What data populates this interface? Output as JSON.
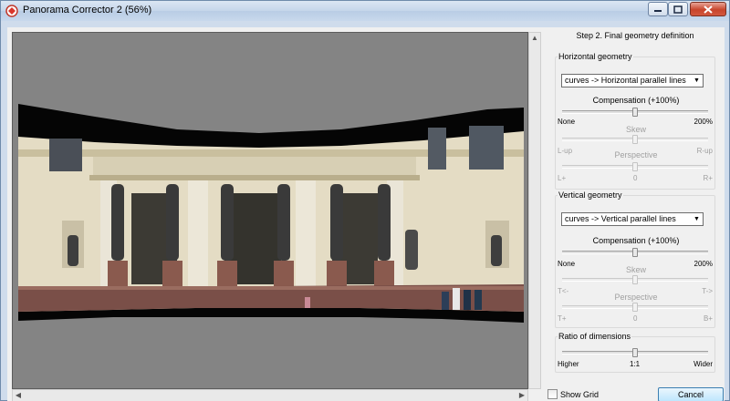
{
  "window": {
    "title": "Panorama Corrector 2 (56%)"
  },
  "panel": {
    "step_title": "Step 2. Final geometry definition",
    "horizontal": {
      "title": "Horizontal geometry",
      "combo_value": "curves -> Horizontal parallel lines",
      "compensation": {
        "label": "Compensation (+100%)",
        "min": "None",
        "max": "200%",
        "value": 0.5
      },
      "skew": {
        "label": "Skew",
        "value": 0.5
      },
      "perspective": {
        "label": "Perspective",
        "left": "L-up",
        "right": "R-up",
        "min": "L+",
        "center": "0",
        "max": "R+",
        "value": 0.5
      }
    },
    "vertical": {
      "title": "Vertical geometry",
      "combo_value": "curves -> Vertical parallel lines",
      "compensation": {
        "label": "Compensation (+100%)",
        "min": "None",
        "max": "200%",
        "value": 0.5
      },
      "skew": {
        "label": "Skew",
        "left": "T<-",
        "right": "T->",
        "value": 0.5
      },
      "perspective": {
        "label": "Perspective",
        "min": "T+",
        "center": "0",
        "max": "B+",
        "value": 0.5
      }
    },
    "ratio": {
      "title": "Ratio of dimensions",
      "min": "Higher",
      "center": "1:1",
      "max": "Wider",
      "value": 0.5
    }
  },
  "footer": {
    "show_grid_label": "Show Grid",
    "show_grid_checked": false,
    "cancel_label": "Cancel"
  },
  "colors": {
    "preview_bg": "#848484",
    "accent": "#3c7fb1"
  }
}
